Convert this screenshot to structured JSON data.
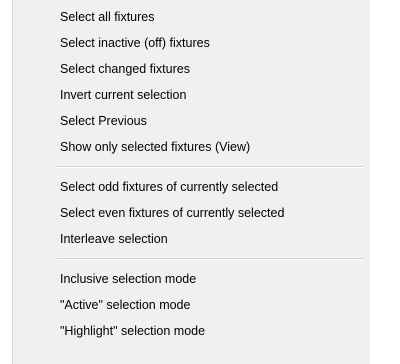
{
  "menu": {
    "groups": [
      {
        "items": [
          "Select all fixtures",
          "Select inactive (off) fixtures",
          "Select changed fixtures",
          "Invert current selection",
          "Select Previous",
          "Show only selected fixtures (View)"
        ]
      },
      {
        "items": [
          "Select odd fixtures of currently selected",
          "Select even fixtures of currently selected",
          "Interleave selection"
        ]
      },
      {
        "items": [
          "Inclusive selection mode",
          "\"Active\" selection mode",
          "\"Highlight\" selection mode"
        ]
      }
    ]
  }
}
